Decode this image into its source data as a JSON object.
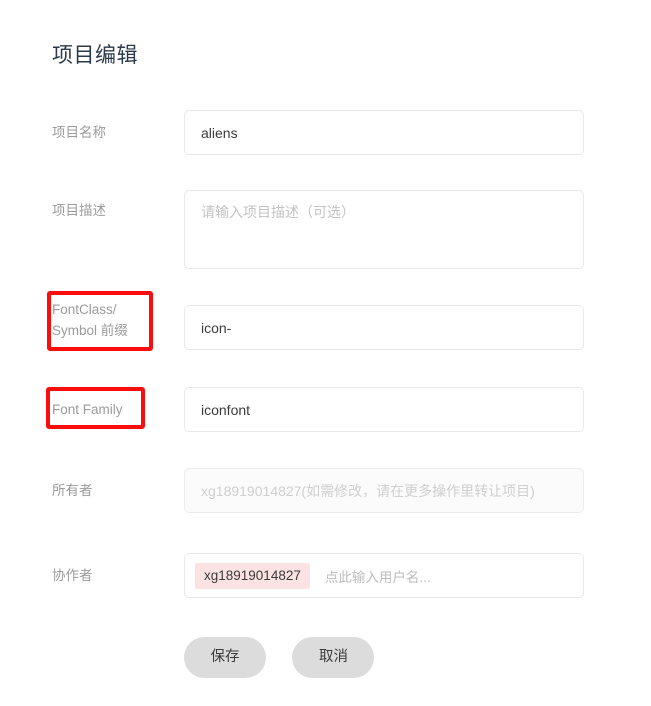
{
  "page": {
    "title": "项目编辑"
  },
  "fields": {
    "project_name": {
      "label": "项目名称",
      "value": "aliens",
      "placeholder": ""
    },
    "project_desc": {
      "label": "项目描述",
      "value": "",
      "placeholder": "请输入项目描述（可选）"
    },
    "font_class_prefix": {
      "label": "FontClass/\nSymbol 前缀",
      "value": "icon-",
      "placeholder": ""
    },
    "font_family": {
      "label": "Font Family",
      "value": "iconfont",
      "placeholder": ""
    },
    "owner": {
      "label": "所有者",
      "value": "",
      "placeholder": "xg18919014827(如需修改，请在更多操作里转让项目)"
    },
    "collaborators": {
      "label": "协作者",
      "tags": [
        "xg18919014827"
      ],
      "placeholder": "点此输入用户名..."
    }
  },
  "buttons": {
    "save": "保存",
    "cancel": "取消"
  },
  "annotations": {
    "highlight_color": "#fb0d0d",
    "boxes": [
      {
        "target": "font-class-prefix-label"
      },
      {
        "target": "font-family-label"
      }
    ]
  },
  "colors": {
    "background": "#ffffff",
    "title": "#2b3a4a",
    "label": "#9b9b9b",
    "value": "#3b3b3b",
    "placeholder": "#c3c3c3",
    "field_border": "#e8e8e8",
    "disabled_bg": "#fbfbfb",
    "tag_bg": "#fbe3e3",
    "button_bg": "#dcdcdc",
    "annotation": "#fb0d0d"
  }
}
